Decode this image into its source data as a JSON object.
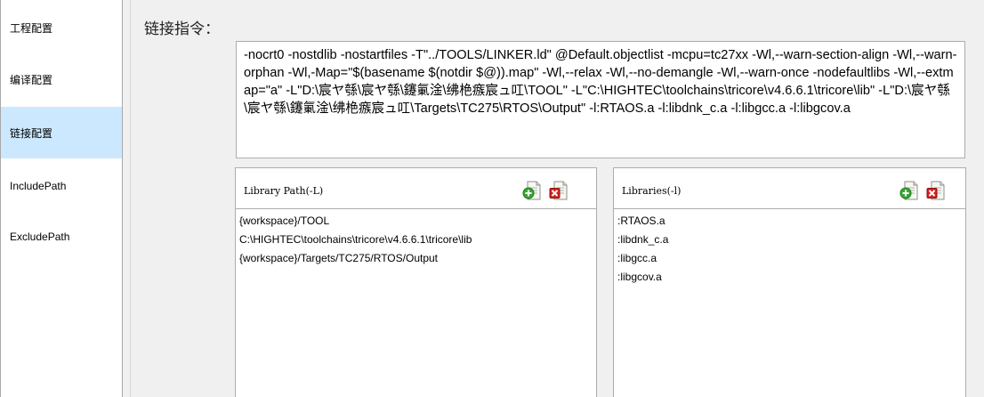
{
  "sidebar": {
    "items": [
      {
        "label": "工程配置",
        "active": false
      },
      {
        "label": "编译配置",
        "active": false
      },
      {
        "label": "链接配置",
        "active": true
      },
      {
        "label": "IncludePath",
        "active": false
      },
      {
        "label": "ExcludePath",
        "active": false
      }
    ]
  },
  "main": {
    "title": "链接指令：",
    "command_text": "-nocrt0 -nostdlib -nostartfiles -T\"../TOOLS/LINKER.ld\" @Default.objectlist -mcpu=tc27xx -Wl,--warn-section-align  -Wl,--warn-orphan  -Wl,-Map=\"$(basename $(notdir $@)).map\" -Wl,--relax -Wl,--no-demangle -Wl,--warn-once -nodefaultlibs -Wl,--extmap=\"a\"   -L\"D:\\宸ヤ綔\\宸ヤ綔\\鑳氭淦\\绋栬瘯宸ュ叿\\TOOL\" -L\"C:\\HIGHTEC\\toolchains\\tricore\\v4.6.6.1\\tricore\\lib\" -L\"D:\\宸ヤ綔\\宸ヤ綔\\鑳氭淦\\绋栬瘯宸ュ叿\\Targets\\TC275\\RTOS\\Output\" -l:RTAOS.a -l:libdnk_c.a -l:libgcc.a -l:libgcov.a"
  },
  "library_path": {
    "title": "Library Path(-L)",
    "items": [
      "{workspace}/TOOL",
      "C:\\HIGHTEC\\toolchains\\tricore\\v4.6.6.1\\tricore\\lib",
      "{workspace}/Targets/TC275/RTOS/Output"
    ]
  },
  "libraries": {
    "title": "Libraries(-l)",
    "items": [
      ":RTAOS.a",
      ":libdnk_c.a",
      ":libgcc.a",
      ":libgcov.a"
    ]
  },
  "icons": {
    "add": "add-file-icon",
    "remove": "remove-file-icon"
  },
  "colors": {
    "active_nav": "#cce8ff",
    "add_green": "#3aa635",
    "remove_red": "#d62020"
  }
}
